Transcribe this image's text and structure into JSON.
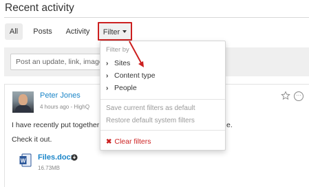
{
  "page": {
    "title": "Recent activity"
  },
  "tabs": [
    {
      "label": "All"
    },
    {
      "label": "Posts"
    },
    {
      "label": "Activity"
    },
    {
      "label": "Filter"
    }
  ],
  "composer": {
    "placeholder": "Post an update, link, image or"
  },
  "filter_menu": {
    "header": "Filter by",
    "items": [
      "Sites",
      "Content type",
      "People"
    ],
    "save_label": "Save current filters as default",
    "restore_label": "Restore default system filters",
    "clear_label": "Clear filters"
  },
  "post": {
    "author": "Peter Jones",
    "meta": "4 hours ago - HighQ",
    "text_line1": "I have recently put together so",
    "text_line1_tail": "e.",
    "text_line2": "Check it out.",
    "attachment": {
      "name": "Files.docx",
      "size": "16.73MB",
      "icon": "word-doc-icon"
    }
  },
  "colors": {
    "accent_link": "#1a85c8",
    "annotation_red": "#cc1f1f"
  }
}
